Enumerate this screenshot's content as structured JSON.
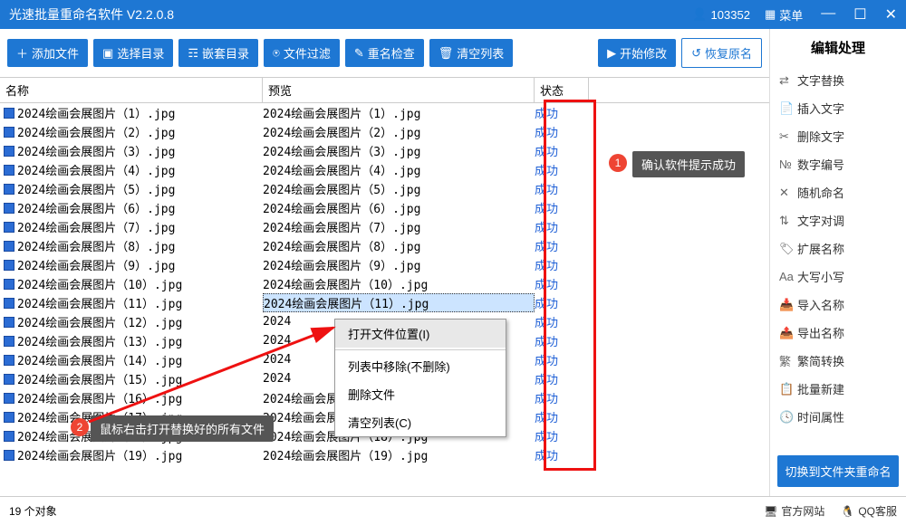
{
  "titlebar": {
    "title": "光速批量重命名软件 V2.2.0.8",
    "user_id": "103352",
    "menu_label": "菜单"
  },
  "toolbar": {
    "add_file": "添加文件",
    "select_dir": "选择目录",
    "nested_dir": "嵌套目录",
    "file_filter": "文件过滤",
    "rename_check": "重名检查",
    "clear_list": "清空列表",
    "start_modify": "开始修改",
    "restore_name": "恢复原名"
  },
  "columns": {
    "name": "名称",
    "preview": "预览",
    "status": "状态"
  },
  "status_text": "成功",
  "rows": [
    {
      "n": "2024绘画会展图片（1）.jpg",
      "p": "2024绘画会展图片（1）.jpg"
    },
    {
      "n": "2024绘画会展图片（2）.jpg",
      "p": "2024绘画会展图片（2）.jpg"
    },
    {
      "n": "2024绘画会展图片（3）.jpg",
      "p": "2024绘画会展图片（3）.jpg"
    },
    {
      "n": "2024绘画会展图片（4）.jpg",
      "p": "2024绘画会展图片（4）.jpg"
    },
    {
      "n": "2024绘画会展图片（5）.jpg",
      "p": "2024绘画会展图片（5）.jpg"
    },
    {
      "n": "2024绘画会展图片（6）.jpg",
      "p": "2024绘画会展图片（6）.jpg"
    },
    {
      "n": "2024绘画会展图片（7）.jpg",
      "p": "2024绘画会展图片（7）.jpg"
    },
    {
      "n": "2024绘画会展图片（8）.jpg",
      "p": "2024绘画会展图片（8）.jpg"
    },
    {
      "n": "2024绘画会展图片（9）.jpg",
      "p": "2024绘画会展图片（9）.jpg"
    },
    {
      "n": "2024绘画会展图片（10）.jpg",
      "p": "2024绘画会展图片（10）.jpg"
    },
    {
      "n": "2024绘画会展图片（11）.jpg",
      "p": "2024绘画会展图片（11）.jpg",
      "sel": true
    },
    {
      "n": "2024绘画会展图片（12）.jpg",
      "p": "2024"
    },
    {
      "n": "2024绘画会展图片（13）.jpg",
      "p": "2024"
    },
    {
      "n": "2024绘画会展图片（14）.jpg",
      "p": "2024"
    },
    {
      "n": "2024绘画会展图片（15）.jpg",
      "p": "2024"
    },
    {
      "n": "2024绘画会展图片（16）.jpg",
      "p": "2024绘画会展图片（16）.jpg"
    },
    {
      "n": "2024绘画会展图片（17）.jpg",
      "p": "2024绘画会展图片（17）.jpg"
    },
    {
      "n": "2024绘画会展图片（18）.jpg",
      "p": "2024绘画会展图片（18）.jpg"
    },
    {
      "n": "2024绘画会展图片（19）.jpg",
      "p": "2024绘画会展图片（19）.jpg"
    }
  ],
  "context_menu": {
    "open_location": "打开文件位置(I)",
    "remove_from_list": "列表中移除(不删除)",
    "delete_file": "删除文件",
    "clear_list": "清空列表(C)"
  },
  "sidebar": {
    "title": "编辑处理",
    "items": [
      "文字替换",
      "插入文字",
      "删除文字",
      "数字编号",
      "随机命名",
      "文字对调",
      "扩展名称",
      "大写小写",
      "导入名称",
      "导出名称",
      "繁简转换",
      "批量新建",
      "时间属性"
    ],
    "switch_btn": "切换到文件夹重命名"
  },
  "statusbar": {
    "count_label": "19 个对象",
    "official_site": "官方网站",
    "qq_support": "QQ客服"
  },
  "callouts": {
    "c1": "确认软件提示成功",
    "c2": "鼠标右击打开替换好的所有文件"
  }
}
